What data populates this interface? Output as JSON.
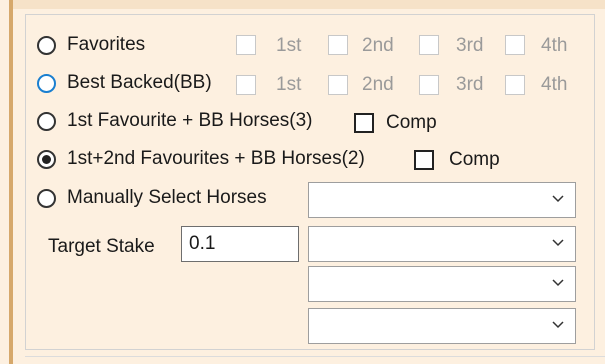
{
  "options": {
    "favorites": {
      "label": "Favorites",
      "checked": false
    },
    "best_backed": {
      "label": "Best Backed(BB)",
      "checked": false,
      "focused": true
    },
    "fav1_bb": {
      "label": "1st Favourite + BB Horses(3)",
      "checked": false,
      "comp_label": "Comp",
      "comp_checked": false
    },
    "fav12_bb": {
      "label": "1st+2nd Favourites + BB Horses(2)",
      "checked": true,
      "comp_label": "Comp",
      "comp_checked": false
    },
    "manual": {
      "label": "Manually Select Horses",
      "checked": false
    }
  },
  "positions": {
    "favorites": [
      "1st",
      "2nd",
      "3rd",
      "4th"
    ],
    "best_backed": [
      "1st",
      "2nd",
      "3rd",
      "4th"
    ]
  },
  "target_stake": {
    "label": "Target Stake",
    "value": "0.1"
  },
  "horse_selects": [
    "",
    "",
    "",
    ""
  ],
  "icons": {
    "dropdown": "chevron-down-icon"
  },
  "colors": {
    "background": "#fdf0e0",
    "accent_bar": "#d6a86b",
    "focus": "#1a7fd0"
  }
}
